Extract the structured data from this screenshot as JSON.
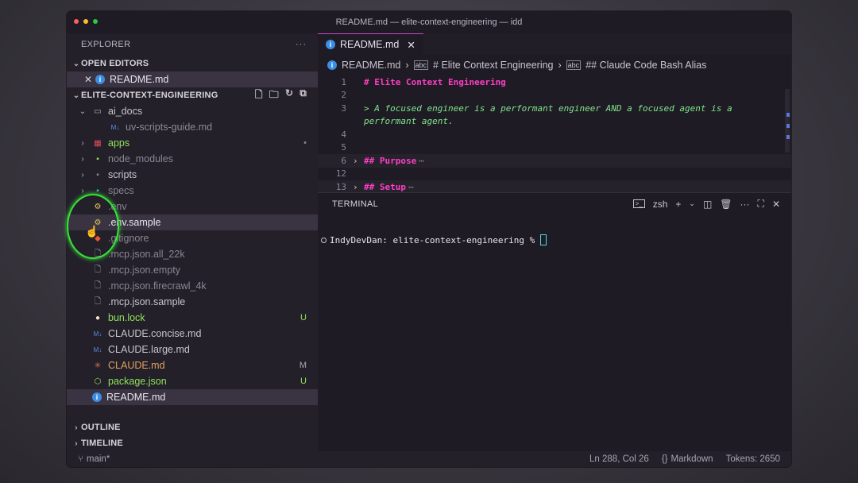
{
  "window": {
    "title": "README.md — elite-context-engineering — idd",
    "traffic_colors": [
      "#ff5f57",
      "#febc2e",
      "#28c840"
    ]
  },
  "explorer": {
    "header": "EXPLORER",
    "more": "···",
    "open_editors_label": "OPEN EDITORS",
    "open_editor_item": "README.md",
    "project_label": "ELITE-CONTEXT-ENGINEERING",
    "tree": [
      {
        "label": "ai_docs",
        "kind": "folder-open",
        "color": "#c9c5cf",
        "indent": 1
      },
      {
        "label": "uv-scripts-guide.md",
        "kind": "md",
        "color": "#8e8a95",
        "indent": 2
      },
      {
        "label": "apps",
        "kind": "folder-apps",
        "color": "#8fe35a",
        "indent": 1,
        "badge": "•",
        "badge_color": "#8a8592"
      },
      {
        "label": "node_modules",
        "kind": "folder-node",
        "color": "#8a8592",
        "indent": 1
      },
      {
        "label": "scripts",
        "kind": "folder-scripts",
        "color": "#c9c5cf",
        "indent": 1
      },
      {
        "label": "specs",
        "kind": "folder-specs",
        "color": "#8a8592",
        "indent": 1
      },
      {
        "label": ".env",
        "kind": "env",
        "color": "#8a8592",
        "indent": 1
      },
      {
        "label": ".env.sample",
        "kind": "env",
        "color": "#e8e4ee",
        "indent": 1,
        "selected": true
      },
      {
        "label": ".gitignore",
        "kind": "git",
        "color": "#8a8592",
        "indent": 1
      },
      {
        "label": ".mcp.json.all_22k",
        "kind": "file",
        "color": "#8a8592",
        "indent": 1
      },
      {
        "label": ".mcp.json.empty",
        "kind": "file",
        "color": "#8a8592",
        "indent": 1
      },
      {
        "label": ".mcp.json.firecrawl_4k",
        "kind": "file",
        "color": "#8a8592",
        "indent": 1
      },
      {
        "label": ".mcp.json.sample",
        "kind": "file",
        "color": "#c9c5cf",
        "indent": 1
      },
      {
        "label": "bun.lock",
        "kind": "bun",
        "color": "#8fe35a",
        "indent": 1,
        "badge": "U",
        "badge_color": "#8fe35a"
      },
      {
        "label": "CLAUDE.concise.md",
        "kind": "md",
        "color": "#c9c5cf",
        "indent": 1
      },
      {
        "label": "CLAUDE.large.md",
        "kind": "md",
        "color": "#c9c5cf",
        "indent": 1
      },
      {
        "label": "CLAUDE.md",
        "kind": "claude",
        "color": "#e0a060",
        "indent": 1,
        "badge": "M",
        "badge_color": "#a9a4b0"
      },
      {
        "label": "package.json",
        "kind": "npm",
        "color": "#8fe35a",
        "indent": 1,
        "badge": "U",
        "badge_color": "#8fe35a"
      },
      {
        "label": "README.md",
        "kind": "info",
        "color": "#e8e4ee",
        "indent": 1,
        "selected2": true
      }
    ],
    "outline_label": "OUTLINE",
    "timeline_label": "TIMELINE"
  },
  "editor": {
    "tab_label": "README.md",
    "breadcrumb": [
      "README.md",
      "# Elite Context Engineering",
      "## Claude Code Bash Alias"
    ],
    "lines": [
      {
        "n": "1",
        "text": "# Elite Context Engineering",
        "style": "heading",
        "fold": false
      },
      {
        "n": "2",
        "text": "",
        "style": "plain",
        "fold": false
      },
      {
        "n": "3",
        "text": "> A focused engineer is a performant engineer AND a focused agent is a",
        "style": "quote",
        "fold": false
      },
      {
        "n": "",
        "text": "performant agent.",
        "style": "quote",
        "fold": false
      },
      {
        "n": "4",
        "text": "",
        "style": "plain",
        "fold": false
      },
      {
        "n": "5",
        "text": "",
        "style": "plain",
        "fold": false
      },
      {
        "n": "6",
        "text": "## Purpose",
        "style": "heading",
        "fold": true
      },
      {
        "n": "12",
        "text": "",
        "style": "plain",
        "fold": false
      },
      {
        "n": "13",
        "text": "## Setup",
        "style": "heading",
        "fold": true
      }
    ]
  },
  "terminal": {
    "label": "TERMINAL",
    "shell": "zsh",
    "prompt": "IndyDevDan: elite-context-engineering % "
  },
  "status": {
    "branch": "main*",
    "position": "Ln 288, Col 26",
    "language": "Markdown",
    "tokens": "Tokens: 2650"
  },
  "colors": {
    "accent": "#c646c8",
    "heading": "#ff3ec6",
    "quote": "#7ee68a",
    "highlight_circle": "#39e33a"
  }
}
